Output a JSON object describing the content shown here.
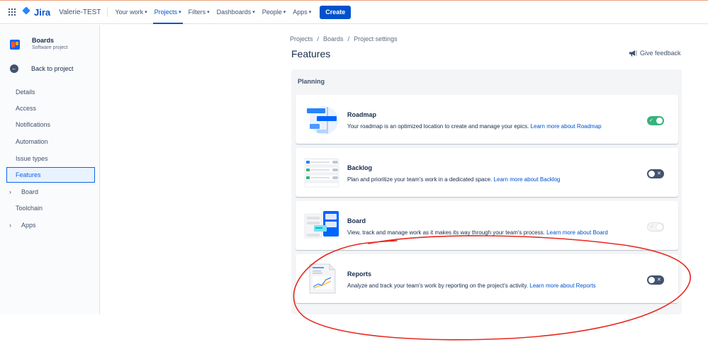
{
  "topnav": {
    "logo_text": "Jira",
    "site_name": "Valerie-TEST",
    "items": [
      {
        "label": "Your work",
        "active": false
      },
      {
        "label": "Projects",
        "active": true
      },
      {
        "label": "Filters",
        "active": false
      },
      {
        "label": "Dashboards",
        "active": false
      },
      {
        "label": "People",
        "active": false
      },
      {
        "label": "Apps",
        "active": false
      }
    ],
    "create_label": "Create"
  },
  "sidebar": {
    "project_name": "Boards",
    "project_type": "Software project",
    "back_label": "Back to project",
    "items": [
      {
        "label": "Details"
      },
      {
        "label": "Access"
      },
      {
        "label": "Notifications"
      },
      {
        "label": "Automation"
      },
      {
        "label": "Issue types"
      },
      {
        "label": "Features",
        "active": true
      },
      {
        "label": "Board",
        "expandable": true
      },
      {
        "label": "Toolchain"
      },
      {
        "label": "Apps",
        "expandable": true
      }
    ]
  },
  "breadcrumbs": [
    "Projects",
    "Boards",
    "Project settings"
  ],
  "page_title": "Features",
  "feedback_label": "Give feedback",
  "planning": {
    "title": "Planning",
    "features": [
      {
        "title": "Roadmap",
        "desc": "Your roadmap is an optimized location to create and manage your epics.",
        "link": "Learn more about Roadmap",
        "toggle": "on",
        "icon": "roadmap-illustration"
      },
      {
        "title": "Backlog",
        "desc": "Plan and prioritize your team's work in a dedicated space.",
        "link": "Learn more about Backlog",
        "toggle": "off",
        "icon": "backlog-illustration"
      },
      {
        "title": "Board",
        "desc": "View, track and manage work as it makes its way through your team's process.",
        "link": "Learn more about Board",
        "toggle": "disabled-on",
        "icon": "board-illustration"
      },
      {
        "title": "Reports",
        "desc": "Analyze and track your team's work by reporting on the project's activity.",
        "link": "Learn more about Reports",
        "toggle": "off",
        "icon": "reports-illustration"
      }
    ]
  },
  "colors": {
    "brand": "#0052cc",
    "toggle_on": "#36b37e",
    "toggle_off": "#42526e",
    "annotation": "#e8281e"
  }
}
